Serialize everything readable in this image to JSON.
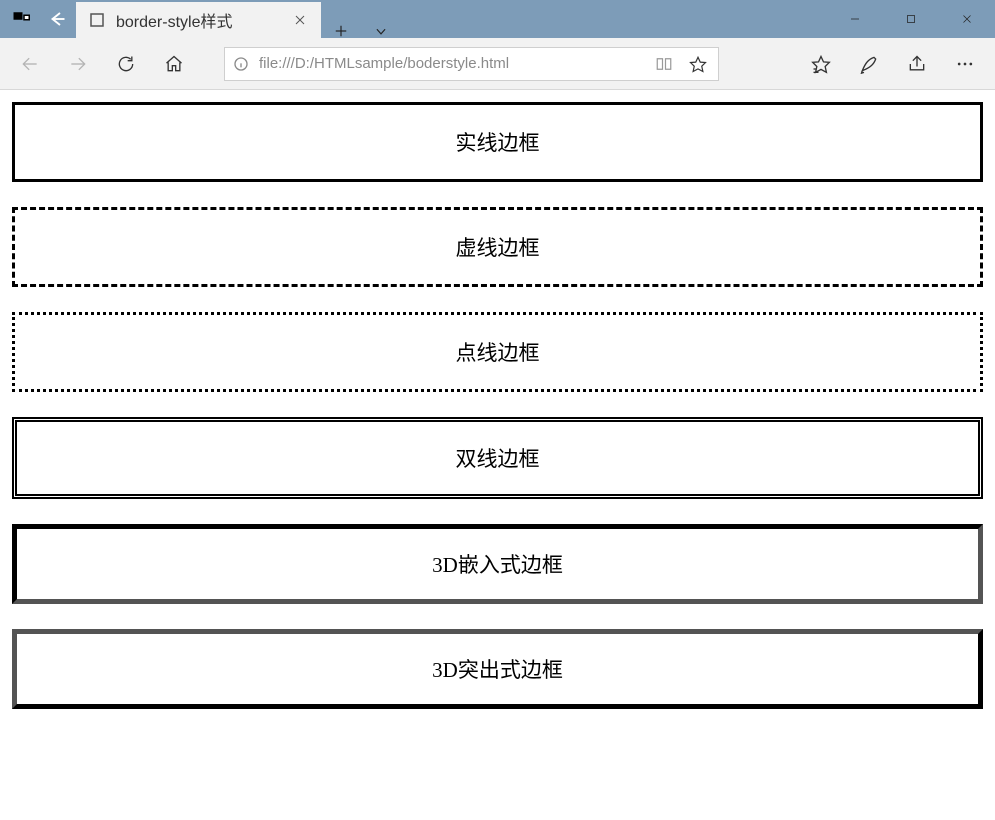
{
  "tab": {
    "title": "border-style样式"
  },
  "addressbar": {
    "url": "file:///D:/HTMLsample/boderstyle.html"
  },
  "page": {
    "boxes": [
      {
        "label": "实线边框",
        "style": "solid"
      },
      {
        "label": "虚线边框",
        "style": "dashed"
      },
      {
        "label": "点线边框",
        "style": "dotted"
      },
      {
        "label": "双线边框",
        "style": "double"
      },
      {
        "label": "3D嵌入式边框",
        "style": "inset"
      },
      {
        "label": "3D突出式边框",
        "style": "outset"
      }
    ]
  }
}
